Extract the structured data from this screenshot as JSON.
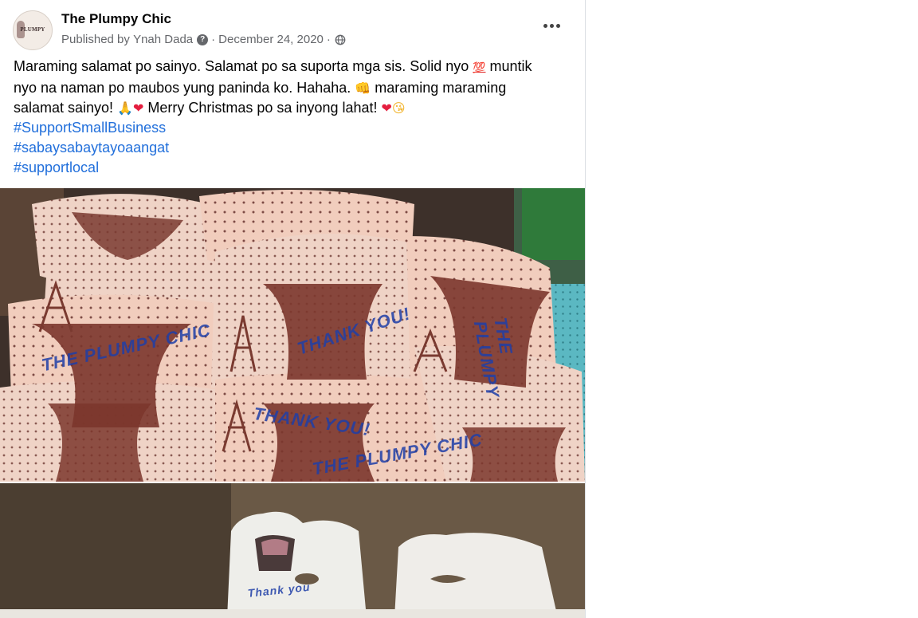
{
  "post": {
    "page_name": "The Plumpy Chic",
    "avatar_text": "PLUMPY",
    "published_prefix": "Published by",
    "publisher": "Ynah Dada",
    "help_icon_glyph": "?",
    "date": "December 24, 2020",
    "separator": "·",
    "privacy_icon": "globe-icon",
    "more_icon": "more-options-icon",
    "text": {
      "line1_a": "Maraming salamat po sainyo. Salamat po sa suporta mga sis. Solid nyo ",
      "emoji_100": "💯",
      "line1_b": " muntik",
      "line2_a": "nyo na naman po maubos yung paninda ko. Hahaha. ",
      "emoji_fist": "👊",
      "line2_b": " maraming maraming",
      "line3_a": "salamat sainyo! ",
      "emoji_pray": "🙏",
      "emoji_heart": "❤",
      "line3_b": " Merry Christmas po sa inyong lahat! ",
      "emoji_heart2": "❤",
      "emoji_kiss": "😘"
    },
    "hashtags": [
      "#SupportSmallBusiness",
      "#sabaysabaytayoaangat",
      "#supportlocal"
    ],
    "photos": [
      {
        "name": "packages-photo",
        "overlay_texts": [
          "THE PLUMPY CHIC",
          "THANK YOU!",
          "THANK YOU!",
          "THE PLUMPY CHIC",
          "THE PLUMPY"
        ]
      },
      {
        "name": "bags-photo",
        "overlay_texts": [
          "Thank you"
        ]
      }
    ]
  },
  "colors": {
    "link": "#216fdb",
    "meta": "#65676b",
    "text": "#050505"
  }
}
